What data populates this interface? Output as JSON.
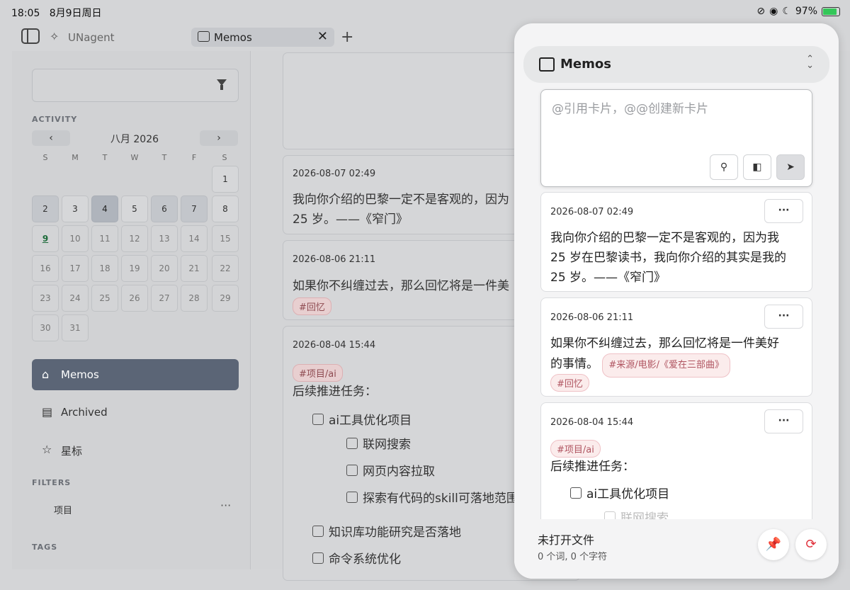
{
  "status": {
    "time": "18:05",
    "date": "8月9日周日",
    "battery": "97%"
  },
  "tabbar": {
    "app_name": "UNagent",
    "tab_label": "Memos",
    "close": "✕",
    "new_tab": "+"
  },
  "sidebar": {
    "activity_label": "ACTIVITY",
    "calendar": {
      "month_title": "八月 2026",
      "prev": "‹",
      "next": "›",
      "weekdays": [
        "S",
        "M",
        "T",
        "W",
        "T",
        "F",
        "S"
      ],
      "days": [
        "1",
        "2",
        "3",
        "4",
        "5",
        "6",
        "7",
        "8",
        "9",
        "10",
        "11",
        "12",
        "13",
        "14",
        "15",
        "16",
        "17",
        "18",
        "19",
        "20",
        "21",
        "22",
        "23",
        "24",
        "25",
        "26",
        "27",
        "28",
        "29",
        "30",
        "31"
      ]
    },
    "nav": {
      "memos": "Memos",
      "archived": "Archived",
      "starred": "星标"
    },
    "filters_label": "FILTERS",
    "filter_item": "项目",
    "filter_more": "···",
    "tags_label": "TAGS"
  },
  "middle": {
    "memo1_date": "2026-08-07 02:49",
    "memo1_line1": "我向你介绍的巴黎一定不是客观的，因为",
    "memo1_line2": "25 岁。——《窄门》",
    "memo2_date": "2026-08-06 21:11",
    "memo2_line1": "如果你不纠缠过去，那么回忆将是一件美",
    "memo2_tag": "#回忆",
    "memo3_date": "2026-08-04 15:44",
    "memo3_tag": "#项目/ai",
    "memo3_heading": "后续推进任务：",
    "memo3_items": [
      "ai工具优化项目",
      "联网搜索",
      "网页内容拉取",
      "探索有代码的skill可落地范围",
      "知识库功能研究是否落地",
      "命令系统优化"
    ]
  },
  "panel": {
    "title": "Memos",
    "chevron": "⌃⌄",
    "editor_placeholder": "@引用卡片，@@创建新卡片",
    "more": "···",
    "memos": [
      {
        "date": "2026-08-07 02:49",
        "lines": [
          "我向你介绍的巴黎一定不是客观的，因为我",
          "25 岁在巴黎读书，我向你介绍的其实是我的",
          "25 岁。——《窄门》"
        ]
      },
      {
        "date": "2026-08-06 21:11",
        "line1": "如果你不纠缠过去，那么回忆将是一件美好",
        "line2": "的事情。",
        "tag_source": "#来源/电影/《爱在三部曲》",
        "tag_memory": "#回忆"
      },
      {
        "date": "2026-08-04 15:44",
        "tag": "#项目/ai",
        "heading": "后续推进任务：",
        "item1": "ai工具优化项目",
        "item2": "联网搜索"
      }
    ],
    "footer_title": "未打开文件",
    "footer_stats": "0 个词, 0 个字符"
  },
  "colors": {
    "active_nav": "#5b6576",
    "tag_bg": "#fbecec",
    "tag_text": "#b05561",
    "refresh_red": "#e0313b"
  }
}
